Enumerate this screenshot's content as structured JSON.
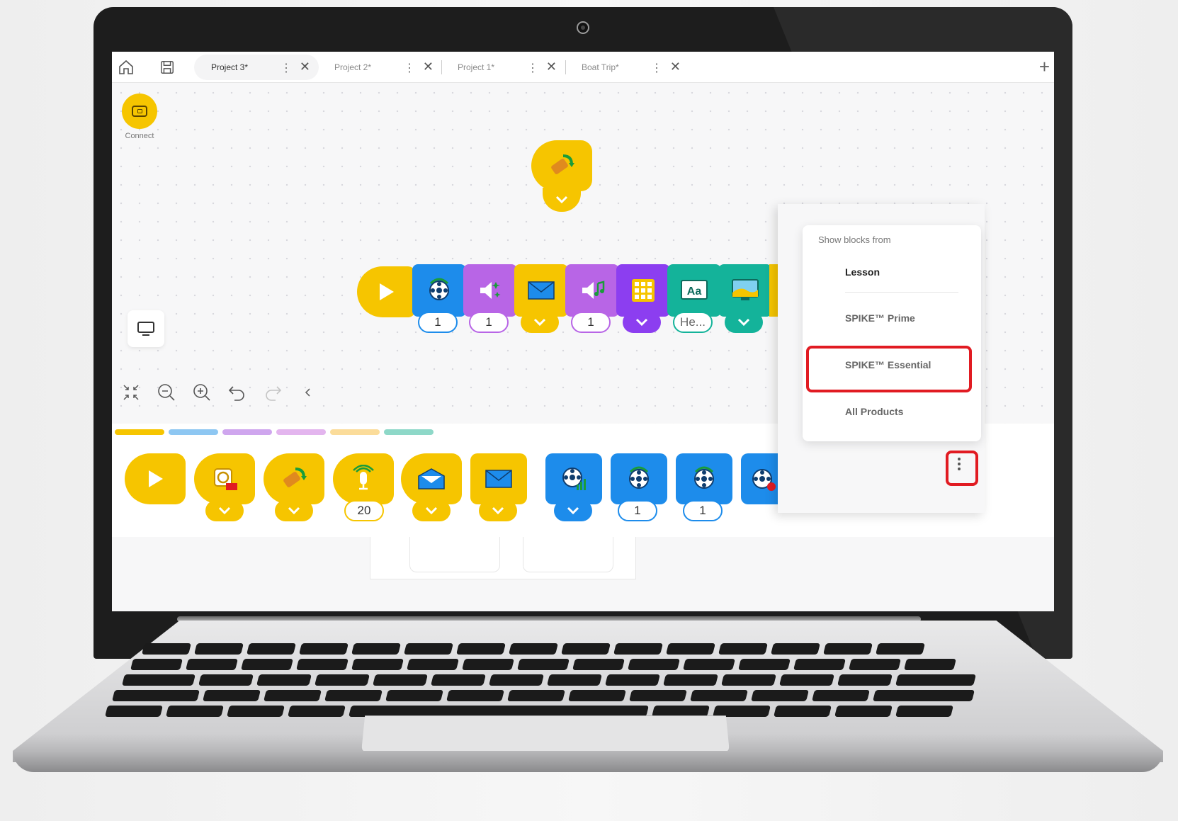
{
  "tabs": [
    {
      "label": "Project 3*",
      "active": true
    },
    {
      "label": "Project 2*",
      "active": false
    },
    {
      "label": "Project 1*",
      "active": false
    },
    {
      "label": "Boat Trip*",
      "active": false
    }
  ],
  "canvas": {
    "connect_label": "Connect",
    "program_inputs": [
      "1",
      "1",
      "1",
      "He..."
    ]
  },
  "palette": {
    "inputs": [
      "20",
      "1",
      "1"
    ],
    "category_colors": [
      "#f6c500",
      "#8ec7f2",
      "#cfa6ee",
      "#e3b5ee",
      "#fbdc9a",
      "#8ed8c8"
    ]
  },
  "menu": {
    "title": "Show blocks from",
    "items": [
      "Lesson",
      "SPIKE™ Prime",
      "SPIKE™ Essential",
      "All Products"
    ],
    "selected": "Lesson",
    "highlighted": "SPIKE™ Essential"
  },
  "colors": {
    "yellow": "#f6c500",
    "blue": "#1d8ceb",
    "purple": "#b865e6",
    "violet": "#8c3ef0",
    "teal": "#14b39a",
    "highlight_red": "#e11b22"
  }
}
